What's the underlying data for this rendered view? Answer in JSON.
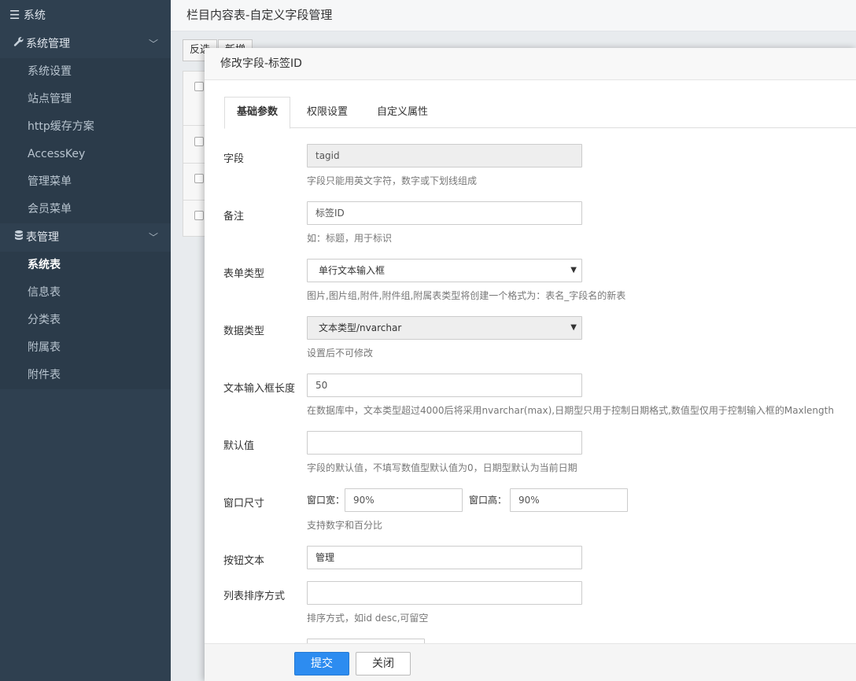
{
  "sidebar": {
    "header": "系统",
    "groups": [
      {
        "label": "系统管理",
        "items": [
          "系统设置",
          "站点管理",
          "http缓存方案",
          "AccessKey",
          "管理菜单",
          "会员菜单"
        ]
      },
      {
        "label": "表管理",
        "items": [
          "系统表",
          "信息表",
          "分类表",
          "附属表",
          "附件表"
        ]
      }
    ]
  },
  "topbar": {
    "title": "栏目内容表-自定义字段管理"
  },
  "background": {
    "btn1": "反选",
    "btn2": "新增"
  },
  "modal": {
    "title": "修改字段-标签ID",
    "tabs": [
      "基础参数",
      "权限设置",
      "自定义属性"
    ],
    "fields": {
      "field": {
        "label": "字段",
        "value": "tagid",
        "help": "字段只能用英文字符，数字或下划线组成"
      },
      "remark": {
        "label": "备注",
        "value": "标签ID",
        "help": "如：标题，用于标识"
      },
      "form_type": {
        "label": "表单类型",
        "value": "单行文本输入框",
        "help": "图片,图片组,附件,附件组,附属表类型将创建一个格式为：表名_字段名的新表"
      },
      "data_type": {
        "label": "数据类型",
        "value": "文本类型/nvarchar",
        "help": "设置后不可修改"
      },
      "length": {
        "label": "文本输入框长度",
        "value": "50",
        "help": "在数据库中，文本类型超过4000后将采用nvarchar(max),日期型只用于控制日期格式,数值型仅用于控制输入框的Maxlength"
      },
      "default": {
        "label": "默认值",
        "value": "",
        "help": "字段的默认值，不填写数值型默认值为0，日期型默认为当前日期"
      },
      "window": {
        "label": "窗口尺寸",
        "width_label": "窗口宽：",
        "width": "90%",
        "height_label": "窗口高：",
        "height": "90%",
        "help": "支持数字和百分比"
      },
      "button_text": {
        "label": "按钮文本",
        "value": "管理"
      },
      "sort": {
        "label": "列表排序方式",
        "value": "",
        "help": "排序方式，如id desc,可留空"
      }
    },
    "footer": {
      "submit": "提交",
      "close": "关闭"
    }
  },
  "colors": {
    "sidebar_bg": "#2f4050",
    "primary": "#2d8cf0"
  },
  "icons": {
    "menu": "hamburger-icon",
    "wrench": "wrench-icon",
    "database": "database-icon",
    "chevron": "chevron-down-icon"
  }
}
